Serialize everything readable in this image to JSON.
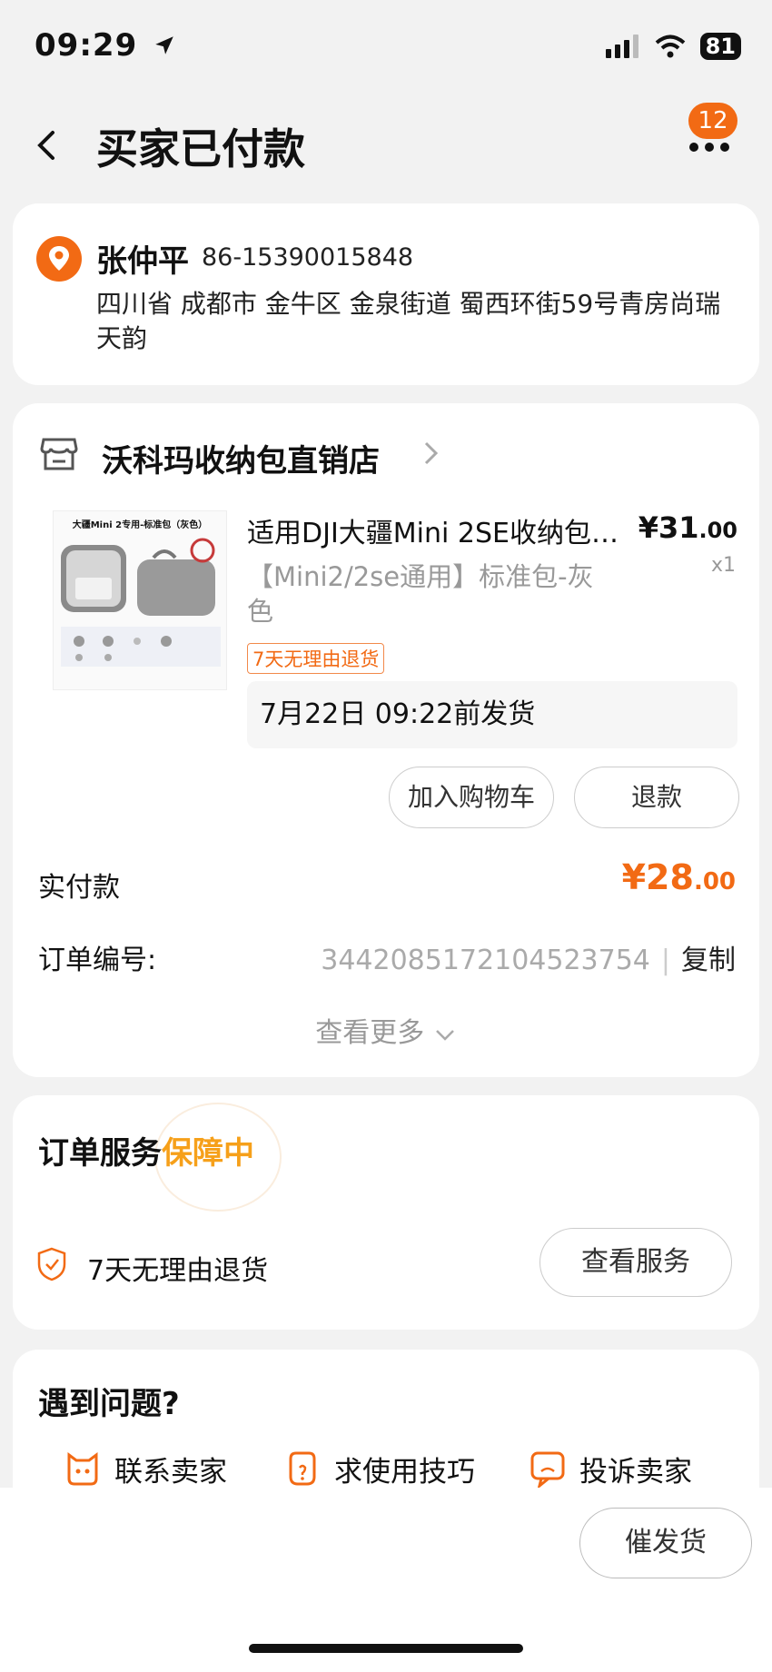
{
  "status_bar": {
    "time": "09:29",
    "battery": "81"
  },
  "header": {
    "title": "买家已付款",
    "badge": "12"
  },
  "address": {
    "name": "张仲平",
    "phone": "86-15390015848",
    "detail": "四川省 成都市 金牛区 金泉街道 蜀西环街59号青房尚瑞天韵"
  },
  "order": {
    "shop_name": "沃科玛收纳包直销店",
    "product": {
      "image_caption": "大疆Mini 2专用-标准包（灰色）",
      "title": "适用DJI大疆Mini 2SE收纳包…",
      "price_int": "¥31",
      "price_dec": ".00",
      "qty": "x1",
      "sku": "【Mini2/2se通用】标准包-灰色",
      "tag": "7天无理由退货",
      "ship": "7月22日 09:22前发货"
    },
    "btn_cart": "加入购物车",
    "btn_refund": "退款",
    "paid_label": "实付款",
    "paid_int": "¥28",
    "paid_dec": ".00",
    "order_no_label": "订单编号:",
    "order_no": "3442085172104523754",
    "sep": "|",
    "copy": "复制",
    "see_more": "查看更多"
  },
  "service": {
    "title_a": "订单服务",
    "title_b": "保障中",
    "item": "7天无理由退货",
    "btn": "查看服务"
  },
  "help": {
    "title": "遇到问题?",
    "items": [
      {
        "label": "联系卖家",
        "icon": "chat-icon"
      },
      {
        "label": "求使用技巧",
        "icon": "tips-icon"
      },
      {
        "label": "投诉卖家",
        "icon": "complaint-icon"
      }
    ]
  },
  "bottom": {
    "urge": "催发货"
  },
  "colors": {
    "accent": "#f26a14",
    "highlight": "#f6a01a"
  }
}
